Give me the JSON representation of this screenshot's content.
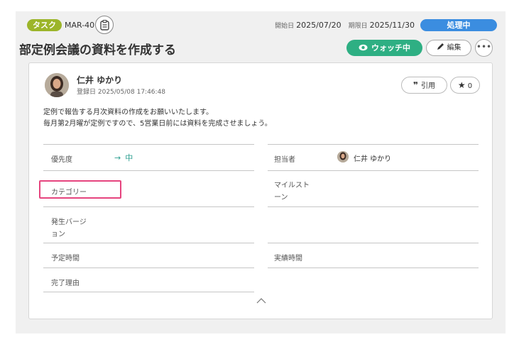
{
  "header": {
    "type_badge": "タスク",
    "issue_key": "MAR-40",
    "start_label": "開始日",
    "start_date": "2025/07/20",
    "due_label": "期限日",
    "due_date": "2025/11/30",
    "status": "処理中"
  },
  "title": "部定例会議の資料を作成する",
  "actions": {
    "watch_label": "ウォッチ中",
    "edit_label": "編集",
    "more_label": "•••"
  },
  "comment": {
    "author": "仁井 ゆかり",
    "registered": "登録日 2025/05/08 17:46:48",
    "quote_label": "引用",
    "star_count": "0",
    "description_line1": "定例で報告する月次資料の作成をお願いいたします。",
    "description_line2": "毎月第2月曜が定例ですので、5営業日前には資料を完成させましょう。"
  },
  "fields": {
    "priority_label": "優先度",
    "priority_value": "中",
    "assignee_label": "担当者",
    "assignee_value": "仁井 ゆかり",
    "category_label": "カテゴリー",
    "milestone_label_1": "マイルスト",
    "milestone_label_2": "ーン",
    "version_label_1": "発生バージ",
    "version_label_2": "ョン",
    "planned_hours_label": "予定時間",
    "actual_hours_label": "実績時間",
    "resolution_label": "完了理由"
  },
  "colors": {
    "type_badge": "#9cb52a",
    "status": "#3b8de0",
    "watch": "#2eaf83",
    "highlight": "#e6447e",
    "priority": "#2a9d8f"
  }
}
